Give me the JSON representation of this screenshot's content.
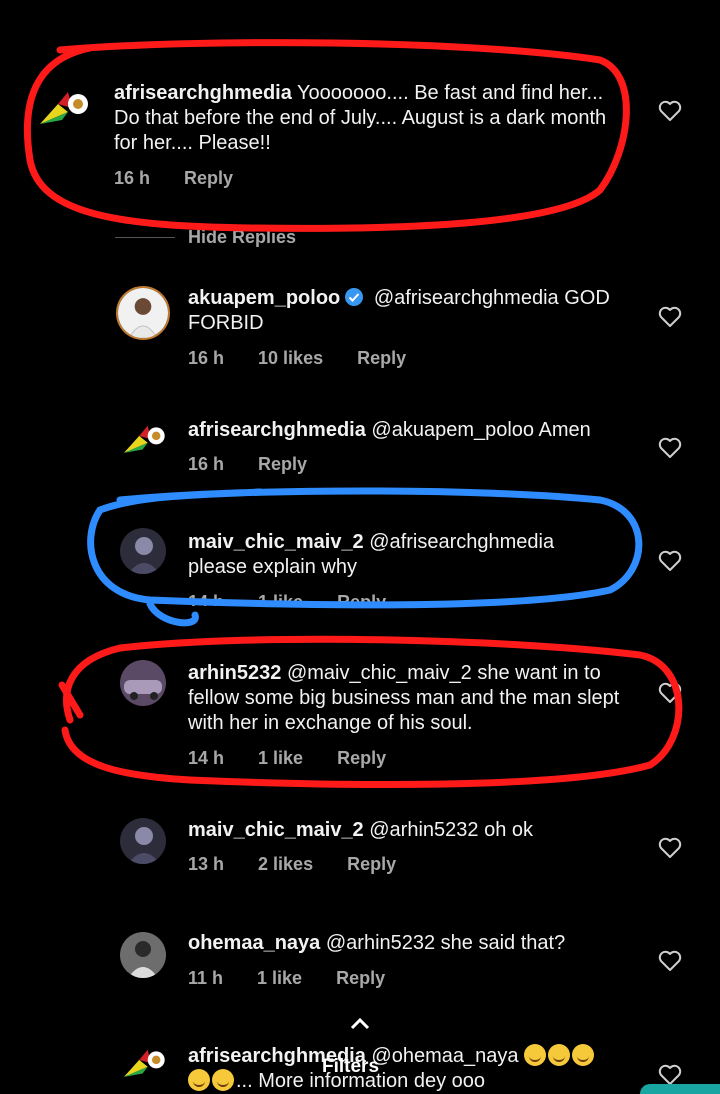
{
  "comments": [
    {
      "username": "afrisearchghmedia",
      "text": " Yooooooo.... Be fast and find her... Do that before the end of July.... August is a dark month for her.... Please!!",
      "time": "16 h",
      "likes": "",
      "reply": "Reply",
      "avatar": "afrisearch-logo"
    },
    {
      "username": "akuapem_poloo",
      "verified": true,
      "text": " @afrisearchghmedia GOD FORBID",
      "time": "16 h",
      "likes": "10 likes",
      "reply": "Reply",
      "avatar": "profile-photo"
    },
    {
      "username": "afrisearchghmedia",
      "text": " @akuapem_poloo Amen",
      "time": "16 h",
      "likes": "",
      "reply": "Reply",
      "avatar": "afrisearch-logo"
    },
    {
      "username": "maiv_chic_maiv_2",
      "text": " @afrisearchghmedia please explain why",
      "time": "14 h",
      "likes": "1 like",
      "reply": "Reply",
      "avatar": "profile-photo"
    },
    {
      "username": "arhin5232",
      "text": " @maiv_chic_maiv_2 she want in to fellow some big business man and the man slept with her in exchange of his soul.",
      "time": "14 h",
      "likes": "1 like",
      "reply": "Reply",
      "avatar": "profile-photo"
    },
    {
      "username": "maiv_chic_maiv_2",
      "text": " @arhin5232 oh ok",
      "time": "13 h",
      "likes": "2 likes",
      "reply": "Reply",
      "avatar": "profile-photo"
    },
    {
      "username": "ohemaa_naya",
      "text": " @arhin5232 she said that?",
      "time": "11 h",
      "likes": "1 like",
      "reply": "Reply",
      "avatar": "profile-photo"
    },
    {
      "username": "afrisearchghmedia",
      "text": " @ohemaa_naya",
      "text2": "... More information dey ooo",
      "time": "",
      "likes": "",
      "reply": "",
      "avatar": "afrisearch-logo"
    }
  ],
  "hide_replies": "Hide Replies",
  "filters": "Filters",
  "colors": {
    "background": "#000000",
    "meta_text": "#a8a8a8",
    "red_annotation": "#ff1a1a",
    "blue_annotation": "#2f8cff",
    "verified_badge": "#3897f0"
  },
  "icons": [
    "heart-outline-icon",
    "verified-badge-icon",
    "chevron-up-icon"
  ]
}
